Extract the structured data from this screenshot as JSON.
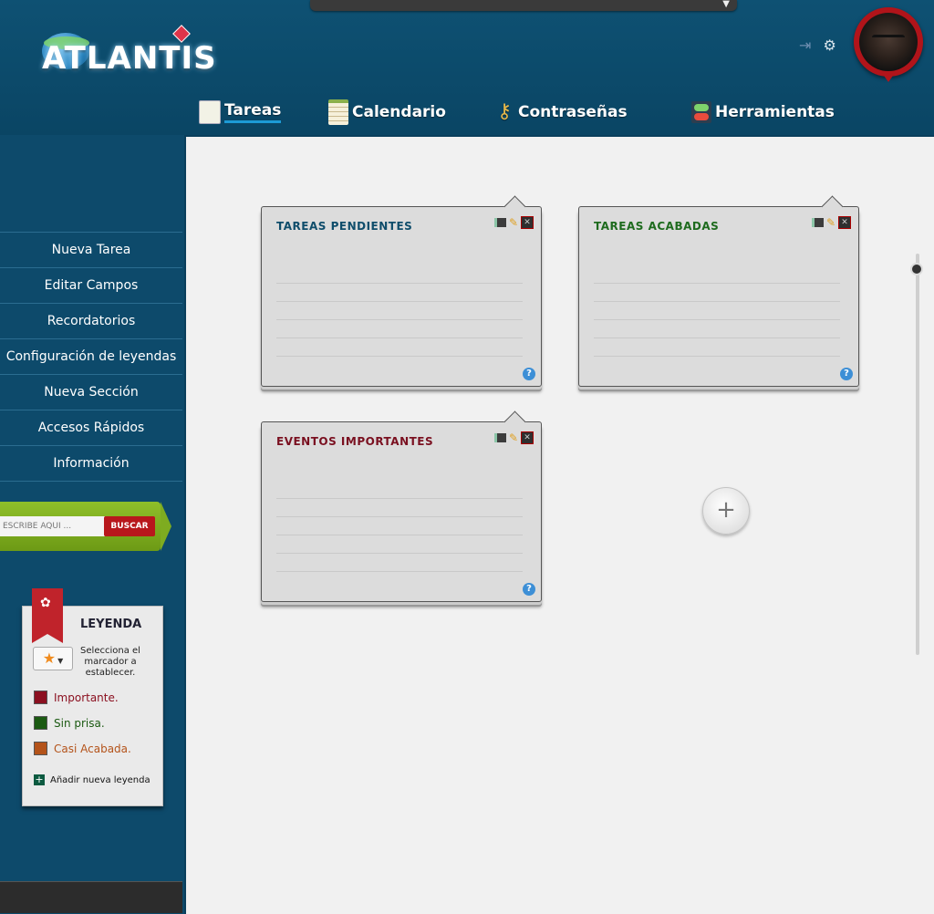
{
  "header": {
    "logo_text": "ATLANTIS",
    "nav": [
      {
        "label": "Tareas",
        "icon": "tasks-icon"
      },
      {
        "label": "Calendario",
        "icon": "calendar-icon"
      },
      {
        "label": "Contraseñas",
        "icon": "key-icon"
      },
      {
        "label": "Herramientas",
        "icon": "tools-icon"
      }
    ],
    "active_tab": "Tareas"
  },
  "sidebar": {
    "menu": [
      "Nueva Tarea",
      "Editar Campos",
      "Recordatorios",
      "Configuración de leyendas",
      "Nueva Sección",
      "Accesos Rápidos",
      "Información"
    ],
    "search": {
      "placeholder": "ESCRIBE AQUÍ ...",
      "button": "BUSCAR"
    },
    "legend": {
      "title": "LEYENDA",
      "hint": "Selecciona el marcador a establecer.",
      "items": [
        {
          "label": "Importante.",
          "color": "#8b1020"
        },
        {
          "label": "Sin prisa.",
          "color": "#1b5a12"
        },
        {
          "label": "Casi Acabada.",
          "color": "#b4531a"
        }
      ],
      "add": "Añadir nueva leyenda"
    }
  },
  "cards": [
    {
      "title": "TAREAS PENDIENTES",
      "color": "#0f4d6b"
    },
    {
      "title": "TAREAS ACABADAS",
      "color": "#1e6b1e"
    },
    {
      "title": "EVENTOS IMPORTANTES",
      "color": "#7a1020"
    }
  ],
  "add_button": "+",
  "help_symbol": "?"
}
